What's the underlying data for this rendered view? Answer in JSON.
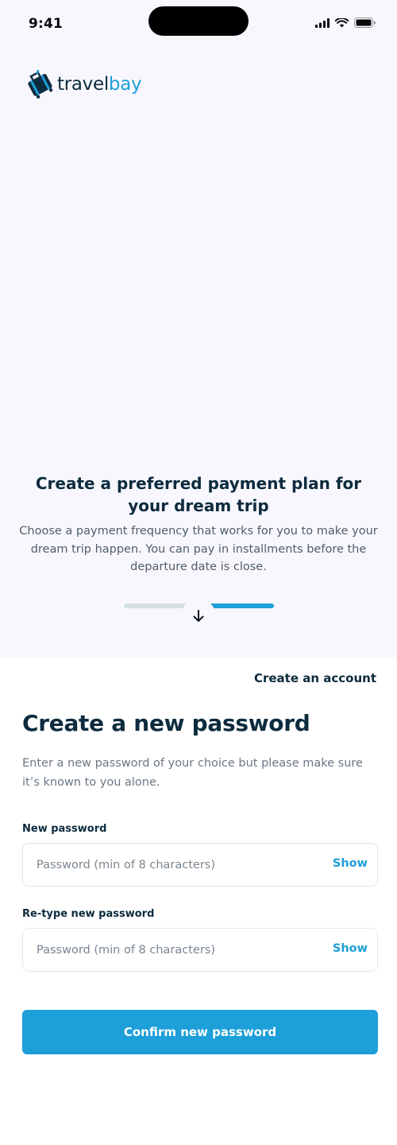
{
  "status_bar": {
    "time": "9:41",
    "icons": [
      "cellular-signal-icon",
      "wifi-icon",
      "battery-icon"
    ]
  },
  "brand": {
    "name_part1": "travel",
    "name_part2": "bay",
    "icon": "suitcase-icon",
    "colors": {
      "primary": "#1d9fd9",
      "dark": "#0d2b3e"
    }
  },
  "hero": {
    "title": "Create a preferred payment plan for your dream trip",
    "description": "Choose a payment frequency that works for you to make your dream trip happen. You can pay in installments before the departure date is close.",
    "carousel": {
      "total_steps": 2,
      "active_step": 2
    },
    "scroll_icon": "arrow-down-icon"
  },
  "header": {
    "create_account": "Create an account"
  },
  "form": {
    "title": "Create a new password",
    "description": "Enter a new password of your choice but please make sure it’s known to you alone.",
    "new_password": {
      "label": "New password",
      "placeholder": "Password (min of 8 characters)",
      "value": "",
      "toggle": "Show"
    },
    "retype_password": {
      "label": "Re-type new password",
      "placeholder": "Password (min of 8 characters)",
      "value": "",
      "toggle": "Show"
    },
    "submit_label": "Confirm new password"
  }
}
